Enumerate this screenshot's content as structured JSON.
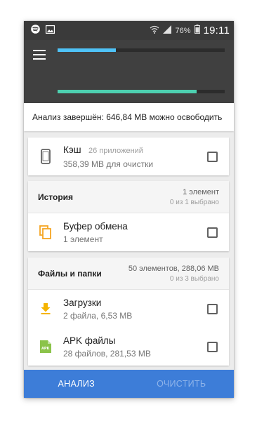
{
  "colors": {
    "accent_blue": "#4fc3f7",
    "accent_teal": "#4dd0b0",
    "bottom_bar": "#3d7dd8",
    "icon_orange": "#f5a623",
    "icon_yellow": "#f5b400",
    "icon_green": "#8bc34a"
  },
  "status_bar": {
    "battery_percent": "76%",
    "time": "19:11",
    "icons": [
      "spotify-icon",
      "image-icon",
      "wifi-icon",
      "signal-icon",
      "battery-icon"
    ]
  },
  "progress": {
    "bar1_fraction": 0.35,
    "bar2_fraction": 0.83
  },
  "summary_text": "Анализ завершён: 646,84 MB можно освободить",
  "cache": {
    "title": "Кэш",
    "hint": "26 приложений",
    "sub": "358,39 MB для очистки"
  },
  "history": {
    "header_title": "История",
    "meta_count": "1 элемент",
    "meta_selected": "0 из 1 выбрано",
    "items": [
      {
        "title": "Буфер обмена",
        "sub": "1 элемент",
        "icon": "clipboard-icon"
      }
    ]
  },
  "files": {
    "header_title": "Файлы и папки",
    "meta_count": "50 элементов, 288,06 MB",
    "meta_selected": "0 из 3 выбрано",
    "items": [
      {
        "title": "Загрузки",
        "sub": "2 файла, 6,53 MB",
        "icon": "download-icon"
      },
      {
        "title": "APK файлы",
        "sub": "28 файлов, 281,53 MB",
        "icon": "apk-icon",
        "icon_text": "APK"
      }
    ]
  },
  "bottom_bar": {
    "analyze_label": "АНАЛИЗ",
    "clean_label": "ОЧИСТИТЬ"
  }
}
